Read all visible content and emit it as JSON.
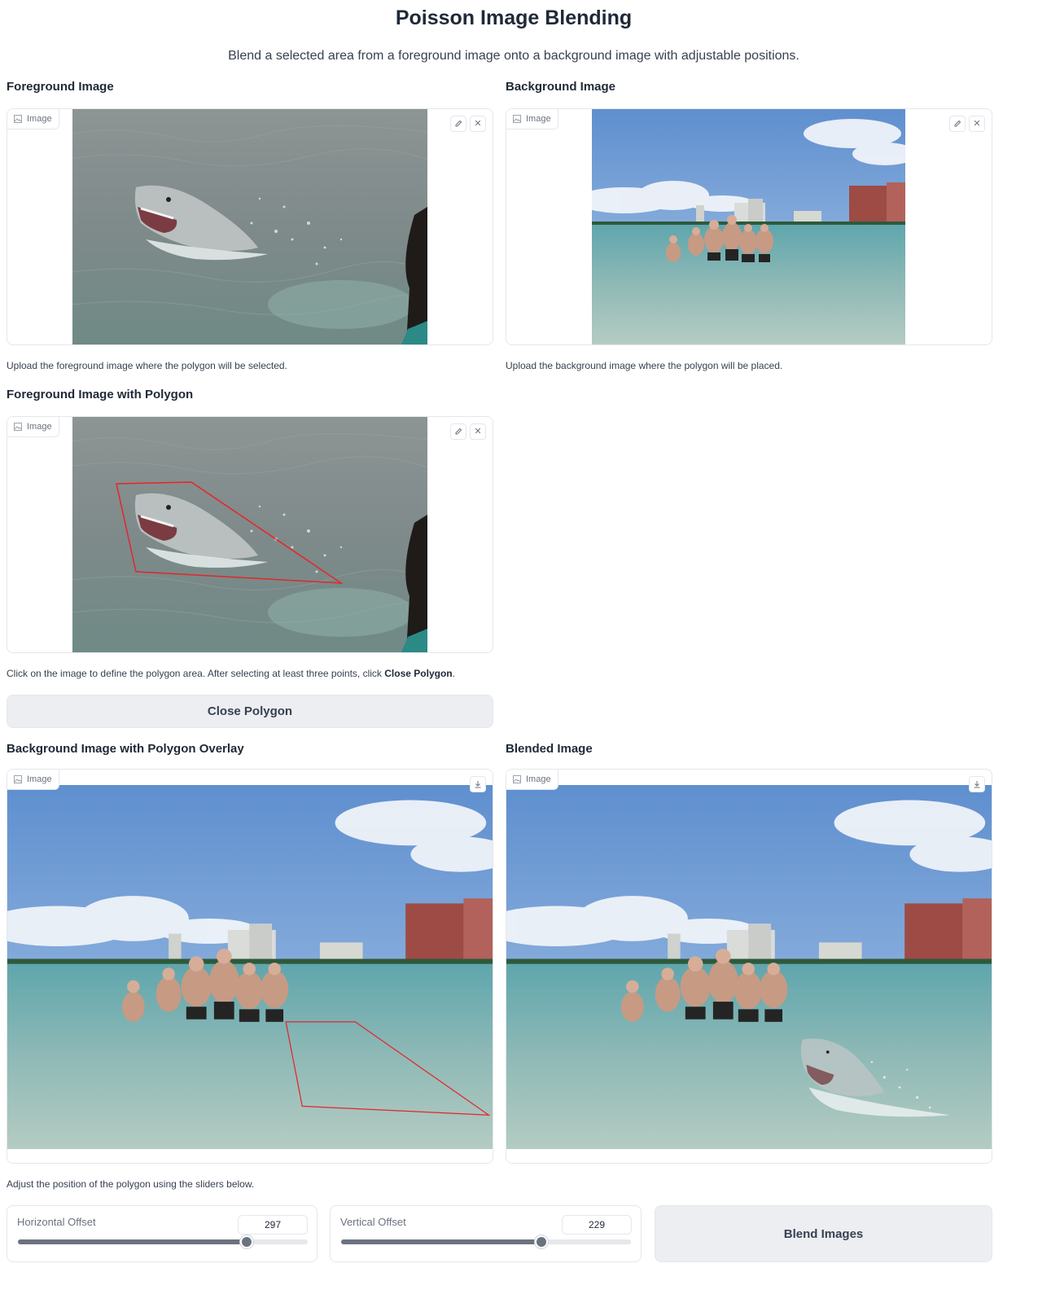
{
  "header": {
    "title": "Poisson Image Blending",
    "subtitle": "Blend a selected area from a foreground image onto a background image with adjustable positions."
  },
  "foreground": {
    "label": "Foreground Image",
    "tag": "Image",
    "hint": "Upload the foreground image where the polygon will be selected."
  },
  "background": {
    "label": "Background Image",
    "tag": "Image",
    "hint": "Upload the background image where the polygon will be placed."
  },
  "fg_polygon": {
    "label": "Foreground Image with Polygon",
    "tag": "Image",
    "hint_prefix": "Click on the image to define the polygon area. After selecting at least three points, click ",
    "hint_bold": "Close Polygon",
    "hint_suffix": "."
  },
  "close_button": {
    "label": "Close Polygon"
  },
  "bg_overlay": {
    "label": "Background Image with Polygon Overlay",
    "tag": "Image"
  },
  "blended": {
    "label": "Blended Image",
    "tag": "Image"
  },
  "sliders_hint": "Adjust the position of the polygon using the sliders below.",
  "horizontal": {
    "label": "Horizontal Offset",
    "value": "297",
    "fraction": 0.79
  },
  "vertical": {
    "label": "Vertical Offset",
    "value": "229",
    "fraction": 0.69
  },
  "blend_button": {
    "label": "Blend Images"
  },
  "icons": {
    "image_tag": "image-icon",
    "edit": "pencil-icon",
    "clear": "close-icon",
    "download": "download-icon"
  }
}
